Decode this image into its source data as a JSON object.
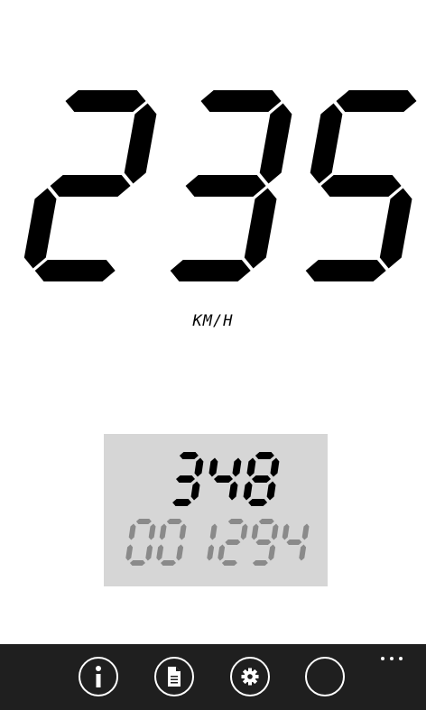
{
  "speedometer": {
    "speed": "235",
    "unit": "KM/H",
    "digit_color": "#000000"
  },
  "odometer_panel": {
    "trip": "348",
    "total": "001294",
    "trip_color": "#000000",
    "total_color": "#8a8a8a",
    "background": "#d6d6d6"
  },
  "app_bar": {
    "background": "#1f1f1f",
    "buttons": [
      {
        "icon": "info-icon"
      },
      {
        "icon": "document-icon"
      },
      {
        "icon": "gear-icon"
      },
      {
        "icon": "circle-icon"
      }
    ],
    "more_icon": "ellipsis-icon"
  }
}
